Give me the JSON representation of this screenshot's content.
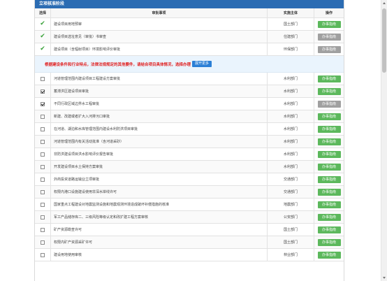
{
  "panel": {
    "title": "立项核准阶段"
  },
  "table": {
    "headers": {
      "select": "选择",
      "matter": "审批事项",
      "subject": "实施主体",
      "op": "操作"
    }
  },
  "required_rows": [
    {
      "matter": "建设项目用地预审",
      "subject": "国土部门",
      "button": "办事指南",
      "button_state": "enabled"
    },
    {
      "matter": "建设项目选址意见（审批）书审查",
      "subject": "住建部门",
      "button": "办事指南",
      "button_state": "disabled"
    },
    {
      "matter": "建设项目（含辐射项目）环境影响评价审批",
      "subject": "环保部门",
      "button": "办事指南",
      "button_state": "disabled"
    }
  ],
  "notice": {
    "text": "根据建设条件和行业特点，法律法规规定的其他要件，请结合项目具体情况，选择办理",
    "button": "展开更多"
  },
  "optional_rows": [
    {
      "checked": false,
      "matter": "河道管理范围内建设项目工程建设方案审批",
      "subject": "水利部门",
      "button": "办事指南",
      "button_state": "enabled"
    },
    {
      "checked": true,
      "matter": "蓄滞洪区建设项目审批",
      "subject": "水利部门",
      "button": "办事指南",
      "button_state": "enabled"
    },
    {
      "checked": true,
      "matter": "不同行政区域边界水工程审批",
      "subject": "水利部门",
      "button": "办事指南",
      "button_state": "disabled"
    },
    {
      "checked": false,
      "matter": "新建、改建或者扩大入河排污口审批",
      "subject": "水利部门",
      "button": "办事指南",
      "button_state": "enabled"
    },
    {
      "checked": false,
      "matter": "在河道、湖泊和水库管理范围内建设水利防洪项目审批",
      "subject": "水利部门",
      "button": "办事指南",
      "button_state": "enabled"
    },
    {
      "checked": false,
      "matter": "河道管理范围内有关活动批准（含河道采砂）",
      "subject": "水利部门",
      "button": "办事指南",
      "button_state": "enabled"
    },
    {
      "checked": false,
      "matter": "非防洪建设项目洪水影响评价报告审批",
      "subject": "水利部门",
      "button": "办事指南",
      "button_state": "enabled"
    },
    {
      "checked": false,
      "matter": "开发建设项目水土保持方案审批",
      "subject": "水利部门",
      "button": "办事指南",
      "button_state": "enabled"
    },
    {
      "checked": false,
      "matter": "外商投资道路运输业立项审批",
      "subject": "交通部门",
      "button": "办事指南",
      "button_state": "enabled"
    },
    {
      "checked": false,
      "matter": "权限内港口设施建设使用非深水岸线许可",
      "subject": "交通部门",
      "button": "办事指南",
      "button_state": "enabled"
    },
    {
      "checked": false,
      "matter": "国家重点工程建设对地震监测设施和地震观测环境造成破坏补偿措施的核准",
      "subject": "地震部门",
      "button": "办事指南",
      "button_state": "enabled"
    },
    {
      "checked": false,
      "matter": "军工产品储存库二、三级风险等级认定和改扩建工程方案审核",
      "subject": "公安部门",
      "button": "办事指南",
      "button_state": "enabled"
    },
    {
      "checked": false,
      "matter": "矿产资源勘查许可",
      "subject": "国土部门",
      "button": "办事指南",
      "button_state": "enabled"
    },
    {
      "checked": false,
      "matter": "权限内矿产资源采矿许可",
      "subject": "国土部门",
      "button": "办事指南",
      "button_state": "enabled"
    },
    {
      "checked": false,
      "matter": "建设用地使用审核",
      "subject": "林业部门",
      "button": "办事指南",
      "button_state": "enabled"
    }
  ],
  "colors": {
    "header_blue": "#2b6cb3",
    "check_green": "#3aa23a",
    "button_green": "#5cb85c",
    "button_gray": "#a0a0a0",
    "notice_red": "#e02020"
  }
}
